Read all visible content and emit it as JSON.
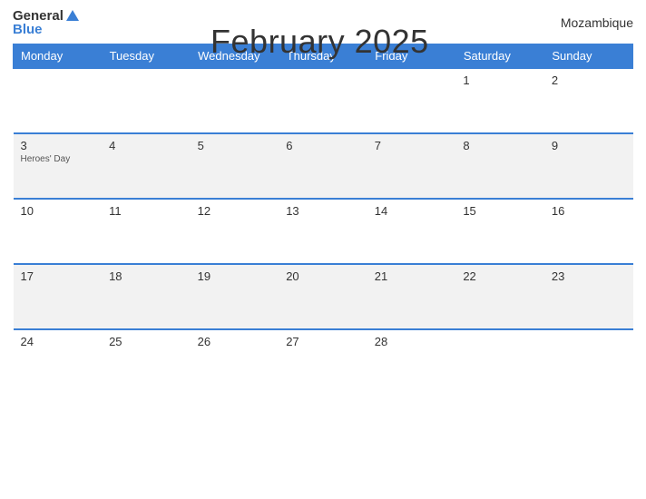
{
  "header": {
    "logo": {
      "general": "General",
      "blue": "Blue"
    },
    "title": "February 2025",
    "country": "Mozambique"
  },
  "calendar": {
    "days_of_week": [
      "Monday",
      "Tuesday",
      "Wednesday",
      "Thursday",
      "Friday",
      "Saturday",
      "Sunday"
    ],
    "weeks": [
      [
        {
          "date": "",
          "holiday": ""
        },
        {
          "date": "",
          "holiday": ""
        },
        {
          "date": "",
          "holiday": ""
        },
        {
          "date": "",
          "holiday": ""
        },
        {
          "date": "",
          "holiday": ""
        },
        {
          "date": "1",
          "holiday": ""
        },
        {
          "date": "2",
          "holiday": ""
        }
      ],
      [
        {
          "date": "3",
          "holiday": "Heroes' Day"
        },
        {
          "date": "4",
          "holiday": ""
        },
        {
          "date": "5",
          "holiday": ""
        },
        {
          "date": "6",
          "holiday": ""
        },
        {
          "date": "7",
          "holiday": ""
        },
        {
          "date": "8",
          "holiday": ""
        },
        {
          "date": "9",
          "holiday": ""
        }
      ],
      [
        {
          "date": "10",
          "holiday": ""
        },
        {
          "date": "11",
          "holiday": ""
        },
        {
          "date": "12",
          "holiday": ""
        },
        {
          "date": "13",
          "holiday": ""
        },
        {
          "date": "14",
          "holiday": ""
        },
        {
          "date": "15",
          "holiday": ""
        },
        {
          "date": "16",
          "holiday": ""
        }
      ],
      [
        {
          "date": "17",
          "holiday": ""
        },
        {
          "date": "18",
          "holiday": ""
        },
        {
          "date": "19",
          "holiday": ""
        },
        {
          "date": "20",
          "holiday": ""
        },
        {
          "date": "21",
          "holiday": ""
        },
        {
          "date": "22",
          "holiday": ""
        },
        {
          "date": "23",
          "holiday": ""
        }
      ],
      [
        {
          "date": "24",
          "holiday": ""
        },
        {
          "date": "25",
          "holiday": ""
        },
        {
          "date": "26",
          "holiday": ""
        },
        {
          "date": "27",
          "holiday": ""
        },
        {
          "date": "28",
          "holiday": ""
        },
        {
          "date": "",
          "holiday": ""
        },
        {
          "date": "",
          "holiday": ""
        }
      ]
    ]
  }
}
